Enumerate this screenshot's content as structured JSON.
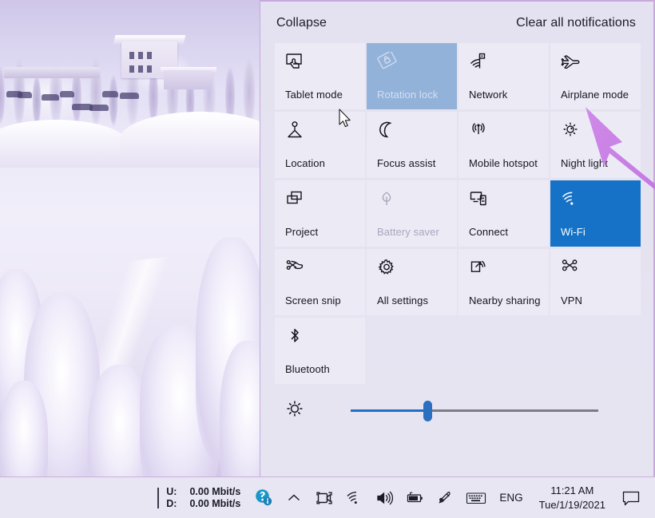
{
  "action_center": {
    "collapse_label": "Collapse",
    "clear_label": "Clear all notifications",
    "tiles": [
      {
        "label": "Tablet mode",
        "icon": "tablet-mode-icon",
        "state": "normal"
      },
      {
        "label": "Rotation lock",
        "icon": "rotation-lock-icon",
        "state": "disabled"
      },
      {
        "label": "Network",
        "icon": "network-icon",
        "state": "normal"
      },
      {
        "label": "Airplane mode",
        "icon": "airplane-icon",
        "state": "normal"
      },
      {
        "label": "Location",
        "icon": "location-icon",
        "state": "normal"
      },
      {
        "label": "Focus assist",
        "icon": "moon-icon",
        "state": "normal"
      },
      {
        "label": "Mobile hotspot",
        "icon": "hotspot-icon",
        "state": "normal"
      },
      {
        "label": "Night light",
        "icon": "sun-icon",
        "state": "normal"
      },
      {
        "label": "Project",
        "icon": "project-icon",
        "state": "normal"
      },
      {
        "label": "Battery saver",
        "icon": "leaf-icon",
        "state": "disabled-text"
      },
      {
        "label": "Connect",
        "icon": "connect-icon",
        "state": "normal"
      },
      {
        "label": "Wi-Fi",
        "icon": "wifi-icon",
        "state": "active"
      },
      {
        "label": "Screen snip",
        "icon": "screen-snip-icon",
        "state": "normal"
      },
      {
        "label": "All settings",
        "icon": "gear-icon",
        "state": "normal"
      },
      {
        "label": "Nearby sharing",
        "icon": "nearby-sharing-icon",
        "state": "normal"
      },
      {
        "label": "VPN",
        "icon": "vpn-icon",
        "state": "normal"
      },
      {
        "label": "Bluetooth",
        "icon": "bluetooth-icon",
        "state": "normal"
      }
    ],
    "brightness": {
      "icon": "brightness-icon",
      "value_percent": 31
    }
  },
  "taskbar": {
    "network_speed": {
      "upload_label": "U:",
      "upload_value": "0.00 Mbit/s",
      "download_label": "D:",
      "download_value": "0.00 Mbit/s"
    },
    "tray_icons": [
      "get-help-icon",
      "show-hidden-icons-chevron",
      "meet-now-icon",
      "wifi-icon",
      "volume-icon",
      "battery-charging-icon",
      "windows-ink-pen-icon",
      "touch-keyboard-icon"
    ],
    "language": "ENG",
    "clock": {
      "time": "11:21 AM",
      "date": "Tue/1/19/2021"
    },
    "notification_icon": "notification-chat-icon"
  },
  "colors": {
    "accent_blue": "#1572c6",
    "disabled_tile_blue": "#93b2da",
    "tile_bg": "#eceaf5",
    "panel_bg": "#e6e3f1",
    "taskbar_bg": "#e8e6f3",
    "annotation_purple": "#c070e0",
    "panel_border": "#c9a8dd"
  }
}
